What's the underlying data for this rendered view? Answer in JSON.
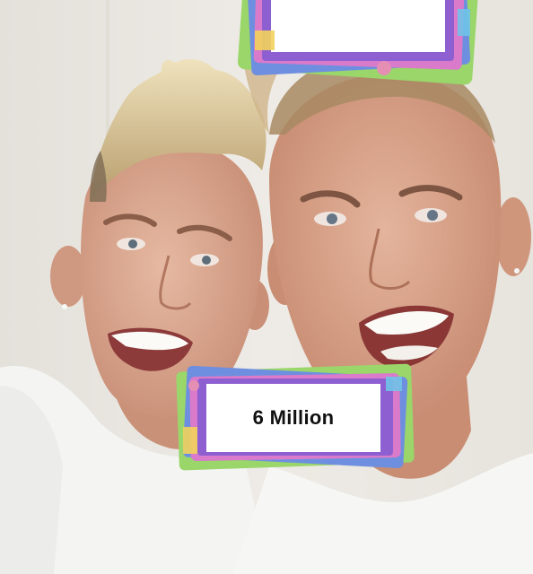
{
  "photo": {
    "label_text": "6 Million",
    "colors": {
      "wall": "#ebe8e2",
      "skin": "#d9a78f",
      "blonde_hair": "#d9c597",
      "shirt": "#f5f5f3",
      "card_pink": "#d97acb",
      "card_green": "#9ad66a",
      "card_blue": "#6e8fe0",
      "card_purple": "#8e5fd0"
    }
  }
}
